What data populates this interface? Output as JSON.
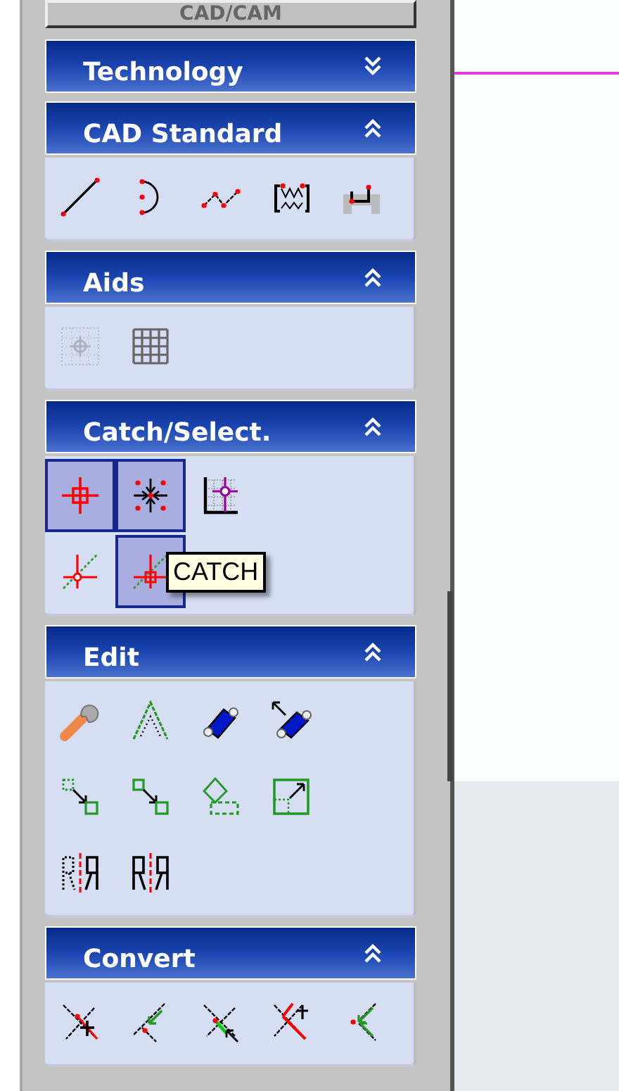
{
  "top_button": {
    "label": "CAD/CAM"
  },
  "sections": [
    {
      "title": "Technology",
      "expanded": false
    },
    {
      "title": "CAD Standard",
      "expanded": true,
      "rows": [
        [
          {
            "pressed": false,
            "disabled": false
          },
          {
            "pressed": false,
            "disabled": false
          },
          {
            "pressed": false,
            "disabled": false
          },
          {
            "pressed": false,
            "disabled": false
          },
          {
            "pressed": false,
            "disabled": false
          }
        ]
      ]
    },
    {
      "title": "Aids",
      "expanded": true,
      "rows": [
        [
          {
            "pressed": false,
            "disabled": true
          },
          {
            "pressed": false,
            "disabled": false
          }
        ]
      ]
    },
    {
      "title": "Catch/Select.",
      "expanded": true,
      "rows": [
        [
          {
            "pressed": true,
            "disabled": false
          },
          {
            "pressed": true,
            "disabled": false
          },
          {
            "pressed": false,
            "disabled": false
          }
        ],
        [
          {
            "pressed": false,
            "disabled": false
          },
          {
            "pressed": true,
            "disabled": false,
            "tooltip": "CATCH"
          }
        ]
      ]
    },
    {
      "title": "Edit",
      "expanded": true,
      "rows": [
        [
          {
            "pressed": false,
            "disabled": false
          },
          {
            "pressed": false,
            "disabled": false
          },
          {
            "pressed": false,
            "disabled": false
          },
          {
            "pressed": false,
            "disabled": false
          }
        ],
        [
          {
            "pressed": false,
            "disabled": false
          },
          {
            "pressed": false,
            "disabled": false
          },
          {
            "pressed": false,
            "disabled": false
          },
          {
            "pressed": false,
            "disabled": false
          }
        ],
        [
          {
            "pressed": false,
            "disabled": false
          },
          {
            "pressed": false,
            "disabled": false
          }
        ]
      ]
    },
    {
      "title": "Convert",
      "expanded": true,
      "rows": [
        [
          {
            "pressed": false,
            "disabled": false
          },
          {
            "pressed": false,
            "disabled": false
          },
          {
            "pressed": false,
            "disabled": false
          },
          {
            "pressed": false,
            "disabled": false
          },
          {
            "pressed": false,
            "disabled": false
          }
        ]
      ]
    }
  ]
}
